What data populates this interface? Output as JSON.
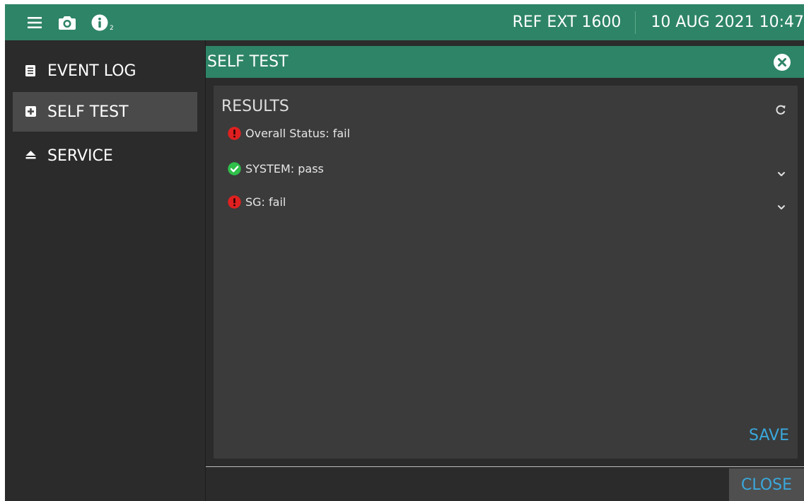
{
  "topbar": {
    "menu_icon": "hamburger-menu-icon",
    "camera_icon": "camera-icon",
    "info_icon": "info-icon",
    "info_badge": "2",
    "ref_label": "REF EXT 1600",
    "datetime": "10 AUG 2021 10:47",
    "color": "#2e8466"
  },
  "sidebar": {
    "items": [
      {
        "label": "EVENT LOG",
        "icon": "list-icon",
        "active": false
      },
      {
        "label": "SELF TEST",
        "icon": "plus-square-icon",
        "active": true
      },
      {
        "label": "SERVICE",
        "icon": "eject-icon",
        "active": false
      }
    ]
  },
  "panel": {
    "title": "SELF TEST",
    "close_icon": "close-circle-icon"
  },
  "results": {
    "title": "RESULTS",
    "refresh_icon": "refresh-icon",
    "rows": [
      {
        "label": "Overall Status: fail",
        "status": "fail",
        "expandable": false
      },
      {
        "label": "SYSTEM: pass",
        "status": "pass",
        "expandable": true
      },
      {
        "label": "SG: fail",
        "status": "fail",
        "expandable": true
      }
    ],
    "save_label": "SAVE"
  },
  "footer": {
    "close_label": "CLOSE"
  },
  "colors": {
    "accent": "#2e8466",
    "fail": "#e02020",
    "pass": "#2fbf4a",
    "link": "#3aa8dc"
  }
}
